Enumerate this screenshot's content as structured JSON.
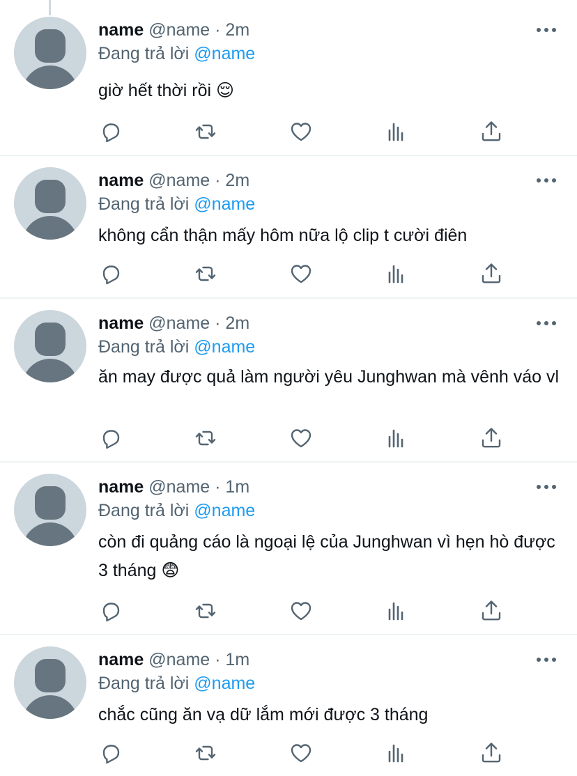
{
  "colors": {
    "accent": "#1d9bf0",
    "muted": "#536471",
    "text": "#0f1419",
    "avatar_bg": "#ccd6dd",
    "avatar_fg": "#66757f"
  },
  "icons": [
    "reply-icon",
    "retweet-icon",
    "like-icon",
    "views-icon",
    "share-icon",
    "more-icon"
  ],
  "tweets": [
    {
      "name": "name",
      "handle": "@name",
      "sep": "·",
      "time": "2m",
      "reply_prefix": "Đang trả lời",
      "mention": "@name",
      "text": "giờ hết thời rồi 😌"
    },
    {
      "name": "name",
      "handle": "@name",
      "sep": "·",
      "time": "2m",
      "reply_prefix": "Đang trả lời",
      "mention": "@name",
      "text": "không cẩn thận mấy hôm nữa lộ clip t cười điên"
    },
    {
      "name": "name",
      "handle": "@name",
      "sep": "·",
      "time": "2m",
      "reply_prefix": "Đang trả lời",
      "mention": "@name",
      "text": "ăn may được quả làm người yêu Junghwan mà vênh váo vl"
    },
    {
      "name": "name",
      "handle": "@name",
      "sep": "·",
      "time": "1m",
      "reply_prefix": "Đang trả lời",
      "mention": "@name",
      "text": "còn đi quảng cáo là ngoại lệ của Junghwan vì hẹn hò được 3 tháng 😨"
    },
    {
      "name": "name",
      "handle": "@name",
      "sep": "·",
      "time": "1m",
      "reply_prefix": "Đang trả lời",
      "mention": "@name",
      "text": "chắc cũng ăn vạ dữ lắm mới được 3 tháng"
    }
  ]
}
